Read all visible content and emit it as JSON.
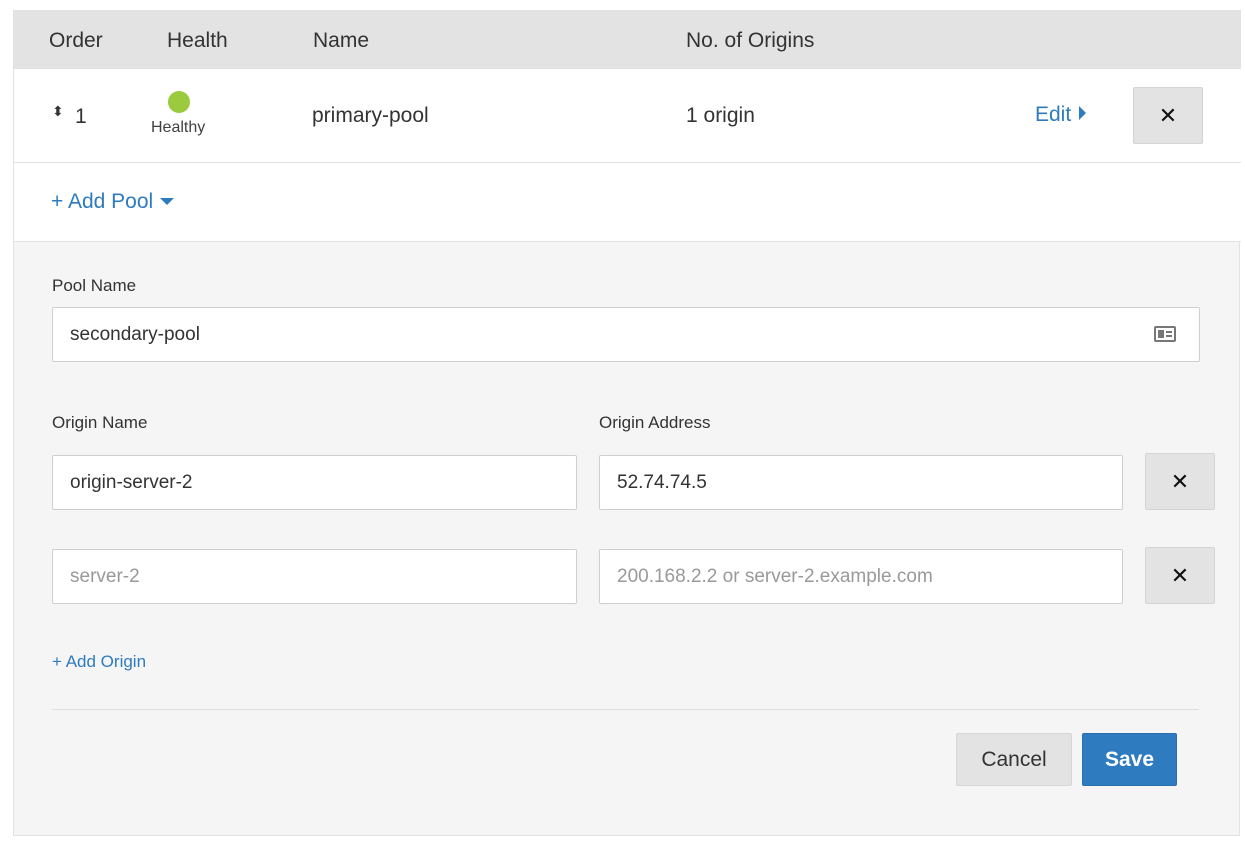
{
  "table": {
    "headers": {
      "order": "Order",
      "health": "Health",
      "name": "Name",
      "origins": "No. of Origins"
    },
    "rows": [
      {
        "order": "1",
        "health_status": "Healthy",
        "health_color": "#9bca3e",
        "name": "primary-pool",
        "origins": "1 origin",
        "edit_label": "Edit",
        "remove_label": "✕"
      }
    ]
  },
  "add_pool_label": "+ Add Pool",
  "form": {
    "pool_name_label": "Pool Name",
    "pool_name_value": "secondary-pool",
    "origin_name_label": "Origin Name",
    "origin_address_label": "Origin Address",
    "origins": [
      {
        "name_value": "origin-server-2",
        "address_value": "52.74.74.5"
      },
      {
        "name_placeholder": "server-2",
        "address_placeholder": "200.168.2.2 or server-2.example.com"
      }
    ],
    "remove_label": "✕",
    "add_origin_label": "+ Add Origin",
    "cancel_label": "Cancel",
    "save_label": "Save"
  },
  "colors": {
    "accent": "#2f7bbf",
    "healthy": "#9bca3e",
    "header_bg": "#e3e3e3",
    "panel_bg": "#f5f5f5"
  }
}
